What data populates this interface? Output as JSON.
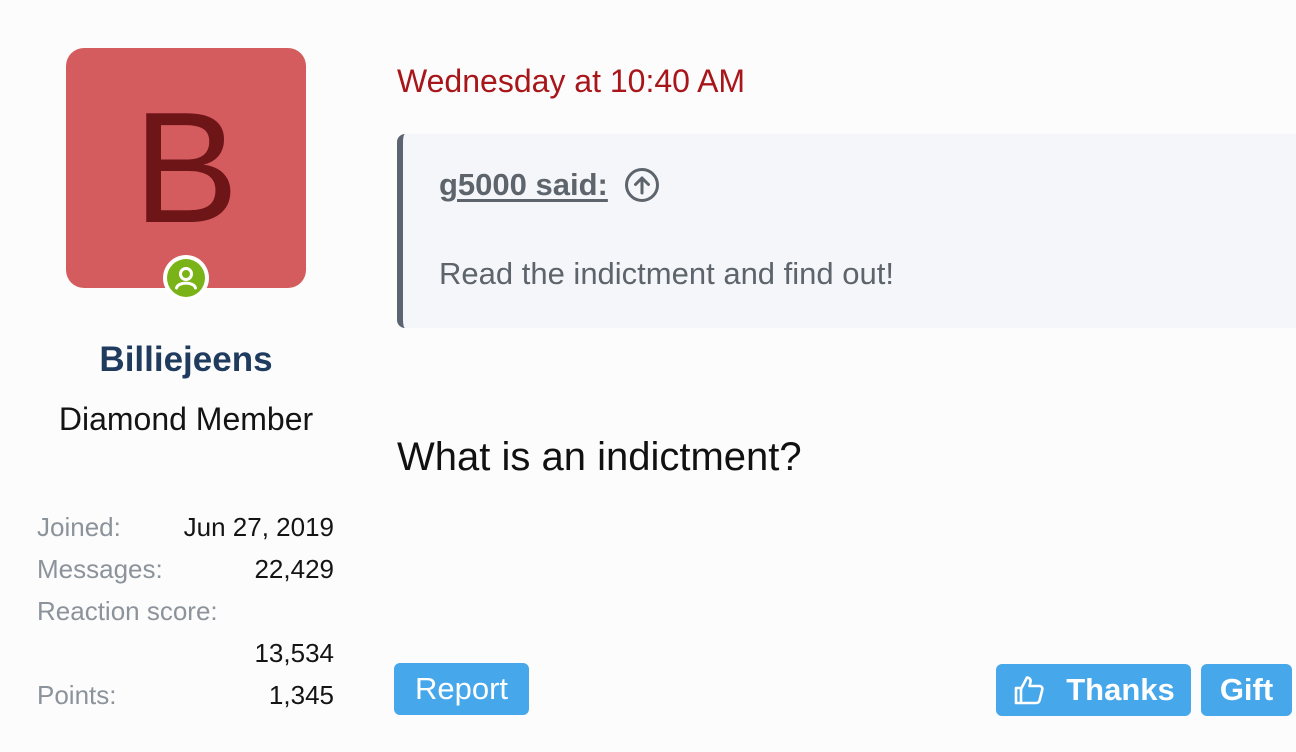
{
  "post": {
    "date": "Wednesday at 10:40 AM",
    "quote": {
      "author_label": "g5000 said:",
      "text": "Read the indictment and find out!"
    },
    "message": "What is an indictment?",
    "actions": {
      "report_label": "Report",
      "thanks_label": "Thanks",
      "gift_label": "Gift"
    }
  },
  "user": {
    "avatar_letter": "B",
    "username": "Billiejeens",
    "title": "Diamond Member",
    "stats": {
      "joined_label": "Joined:",
      "joined_value": "Jun 27, 2019",
      "messages_label": "Messages:",
      "messages_value": "22,429",
      "reaction_label": "Reaction score:",
      "reaction_value": "13,534",
      "points_label": "Points:",
      "points_value": "1,345"
    }
  },
  "colors": {
    "avatar_bg": "#d45b5e",
    "avatar_letter": "#6e1518",
    "online": "#7ab317",
    "date": "#a8161a",
    "username": "#1f3b5e",
    "button": "#47a7eb"
  },
  "icons": {
    "online": "online-user-icon",
    "quote_jump": "arrow-up-circle-icon",
    "thanks": "thumbs-up-icon"
  }
}
